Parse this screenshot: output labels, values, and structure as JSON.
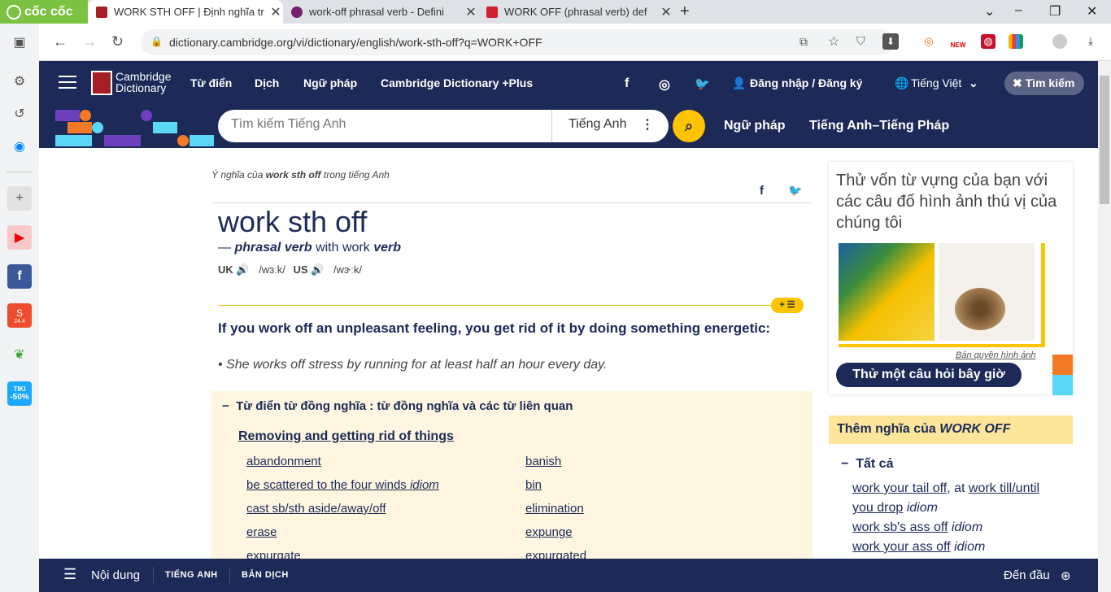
{
  "browser": {
    "brand": "cốc cốc",
    "tabs": [
      {
        "title": "WORK STH OFF | Định nghĩa tr"
      },
      {
        "title": "work-off phrasal verb - Defini"
      },
      {
        "title": "WORK OFF (phrasal verb) def"
      }
    ],
    "url": "dictionary.cambridge.org/vi/dictionary/english/work-sth-off?q=WORK+OFF",
    "ext_new_badge": "NEW"
  },
  "sidebar": {
    "shopee_badge": "24.4",
    "tiki_label": "TIKI",
    "tiki_discount": "-50%"
  },
  "header": {
    "logo_line1": "Cambridge",
    "logo_line2": "Dictionary",
    "nav": [
      "Từ điển",
      "Dịch",
      "Ngữ pháp",
      "Cambridge Dictionary +Plus"
    ],
    "login": "Đăng nhập / Đăng ký",
    "language": "Tiếng Việt",
    "search_toggle": "Tìm kiếm"
  },
  "search": {
    "placeholder": "Tìm kiếm Tiếng Anh",
    "lang": "Tiếng Anh",
    "links": [
      "Ngữ pháp",
      "Tiếng Anh–Tiếng Pháp"
    ]
  },
  "entry": {
    "crumb_prefix": "Ý nghĩa của",
    "crumb_word": "work sth off",
    "crumb_suffix": "trong tiếng Anh",
    "headword": "work sth off",
    "pos_dash": "—",
    "pos": "phrasal verb",
    "pos_with": "with work",
    "pos_verb": "verb",
    "uk_label": "UK",
    "uk_ipa": "/wɜːk/",
    "us_label": "US",
    "us_ipa": "/wɝːk/",
    "badge": "+ ☰",
    "definition": "If you work off an unpleasant feeling, you get rid of it by doing something energetic:",
    "example": "She works off stress by running for at least half an hour every day."
  },
  "thesaurus": {
    "title": "Từ điển từ đồng nghĩa : từ đồng nghĩa và các từ liên quan",
    "subtitle": "Removing and getting rid of things",
    "col1": [
      {
        "text": "abandonment",
        "tag": ""
      },
      {
        "text": "be scattered to the four winds",
        "tag": "idiom"
      },
      {
        "text": "cast sb/sth aside/away/off",
        "tag": ""
      },
      {
        "text": "erase",
        "tag": ""
      },
      {
        "text": "expurgate",
        "tag": ""
      }
    ],
    "col2": [
      {
        "text": "banish",
        "tag": ""
      },
      {
        "text": "bin",
        "tag": ""
      },
      {
        "text": "elimination",
        "tag": ""
      },
      {
        "text": "expunge",
        "tag": ""
      },
      {
        "text": "expurgated",
        "tag": ""
      }
    ]
  },
  "right": {
    "quiz_title": "Thử vốn từ vựng của bạn với các câu đố hình ảnh thú vị của chúng tôi",
    "credit": "Bản quyền hình ảnh",
    "quiz_button": "Thử một câu hỏi bây giờ",
    "more_prefix": "Thêm nghĩa của",
    "more_word": "WORK OFF",
    "all_label": "Tất cả",
    "r1a": "work your tail off",
    "r1b": ", at",
    "r1c": "work till/until",
    "r2a": "you drop",
    "r2b": "idiom",
    "r3a": "work sb's ass off",
    "r3b": "idiom",
    "r4a": "work your ass off",
    "r4b": "idiom"
  },
  "bottom": {
    "contents": "Nội dung",
    "tab1": "TIẾNG ANH",
    "tab2": "BẢN DỊCH",
    "to_top": "Đến đầu"
  }
}
